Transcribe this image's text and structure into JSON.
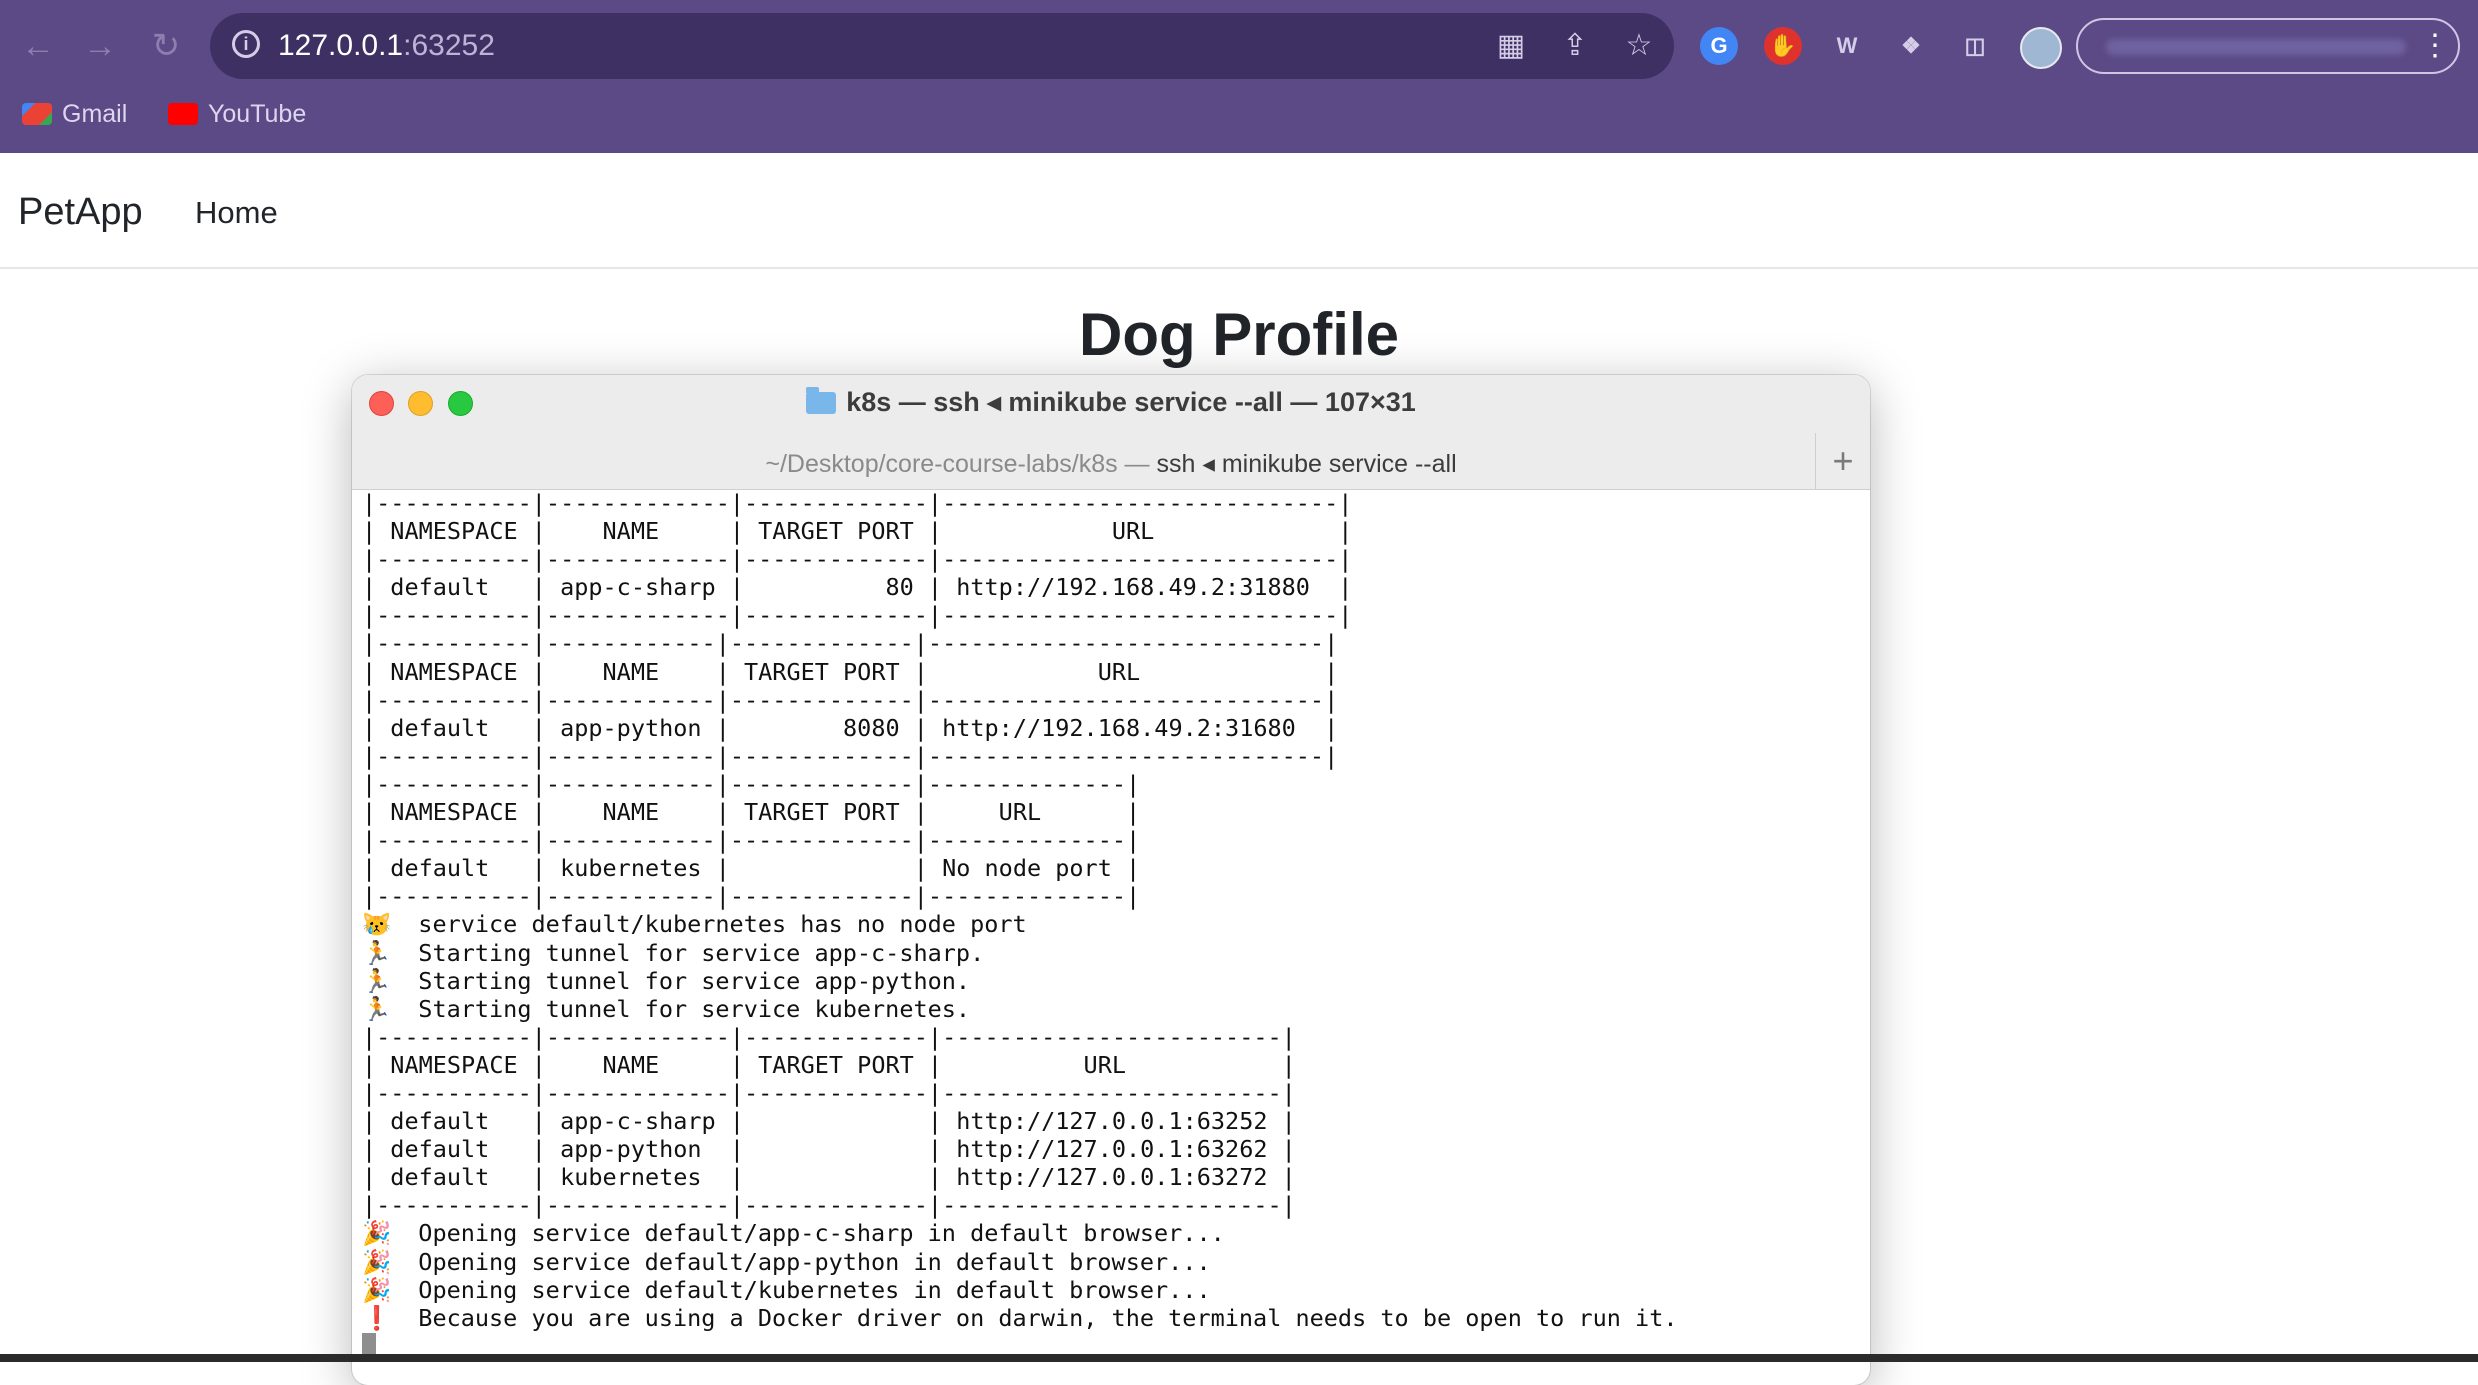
{
  "browser": {
    "url_host": "127.0.0.1",
    "url_port": ":63252",
    "bookmarks": [
      {
        "label": "Gmail",
        "icon": "gmail-icon",
        "color": "#ea4335"
      },
      {
        "label": "YouTube",
        "icon": "youtube-icon",
        "color": "#ff0000"
      }
    ],
    "toolbar_icons": [
      "back-icon",
      "forward-icon",
      "reload-icon",
      "translate-icon",
      "share-icon",
      "bookmark-star-icon",
      "google-extension-icon",
      "adblock-extension-icon",
      "w-extension-icon",
      "puzzle-extensions-icon",
      "side-panel-icon",
      "profile-avatar-icon"
    ],
    "colors": {
      "chrome": "#5b4a86",
      "omnibox": "#3f3063"
    }
  },
  "site": {
    "brand": "PetApp",
    "nav_home": "Home",
    "title": "Dog Profile"
  },
  "terminal": {
    "title": "k8s — ssh ◂ minikube service --all — 107×31",
    "tab_path": "~/Desktop/core-course-labs/k8s — ",
    "tab_command": "ssh ◂ minikube service --all",
    "tab_add": "+",
    "lines": [
      {
        "e": "",
        "t": "|-----------|-------------|-------------|----------------------------|"
      },
      {
        "e": "",
        "t": "| NAMESPACE |    NAME     | TARGET PORT |            URL             |"
      },
      {
        "e": "",
        "t": "|-----------|-------------|-------------|----------------------------|"
      },
      {
        "e": "",
        "t": "| default   | app-c-sharp |          80 | http://192.168.49.2:31880  |"
      },
      {
        "e": "",
        "t": "|-----------|-------------|-------------|----------------------------|"
      },
      {
        "e": "",
        "t": "|-----------|------------|-------------|----------------------------|"
      },
      {
        "e": "",
        "t": "| NAMESPACE |    NAME    | TARGET PORT |            URL             |"
      },
      {
        "e": "",
        "t": "|-----------|------------|-------------|----------------------------|"
      },
      {
        "e": "",
        "t": "| default   | app-python |        8080 | http://192.168.49.2:31680  |"
      },
      {
        "e": "",
        "t": "|-----------|------------|-------------|----------------------------|"
      },
      {
        "e": "",
        "t": "|-----------|------------|-------------|--------------|"
      },
      {
        "e": "",
        "t": "| NAMESPACE |    NAME    | TARGET PORT |     URL      |"
      },
      {
        "e": "",
        "t": "|-----------|------------|-------------|--------------|"
      },
      {
        "e": "",
        "t": "| default   | kubernetes |             | No node port |"
      },
      {
        "e": "",
        "t": "|-----------|------------|-------------|--------------|"
      },
      {
        "e": "😿",
        "k": "cat",
        "t": "  service default/kubernetes has no node port"
      },
      {
        "e": "🏃",
        "k": "run",
        "t": "  Starting tunnel for service app-c-sharp."
      },
      {
        "e": "🏃",
        "k": "run",
        "t": "  Starting tunnel for service app-python."
      },
      {
        "e": "🏃",
        "k": "run",
        "t": "  Starting tunnel for service kubernetes."
      },
      {
        "e": "",
        "t": "|-----------|-------------|-------------|------------------------|"
      },
      {
        "e": "",
        "t": "| NAMESPACE |    NAME     | TARGET PORT |          URL           |"
      },
      {
        "e": "",
        "t": "|-----------|-------------|-------------|------------------------|"
      },
      {
        "e": "",
        "t": "| default   | app-c-sharp |             | http://127.0.0.1:63252 |"
      },
      {
        "e": "",
        "t": "| default   | app-python  |             | http://127.0.0.1:63262 |"
      },
      {
        "e": "",
        "t": "| default   | kubernetes  |             | http://127.0.0.1:63272 |"
      },
      {
        "e": "",
        "t": "|-----------|-------------|-------------|------------------------|"
      },
      {
        "e": "🎉",
        "k": "party",
        "t": "  Opening service default/app-c-sharp in default browser..."
      },
      {
        "e": "🎉",
        "k": "party",
        "t": "  Opening service default/app-python in default browser..."
      },
      {
        "e": "🎉",
        "k": "party",
        "t": "  Opening service default/kubernetes in default browser..."
      },
      {
        "e": "❗",
        "k": "bang",
        "t": "  Because you are using a Docker driver on darwin, the terminal needs to be open to run it."
      }
    ]
  }
}
